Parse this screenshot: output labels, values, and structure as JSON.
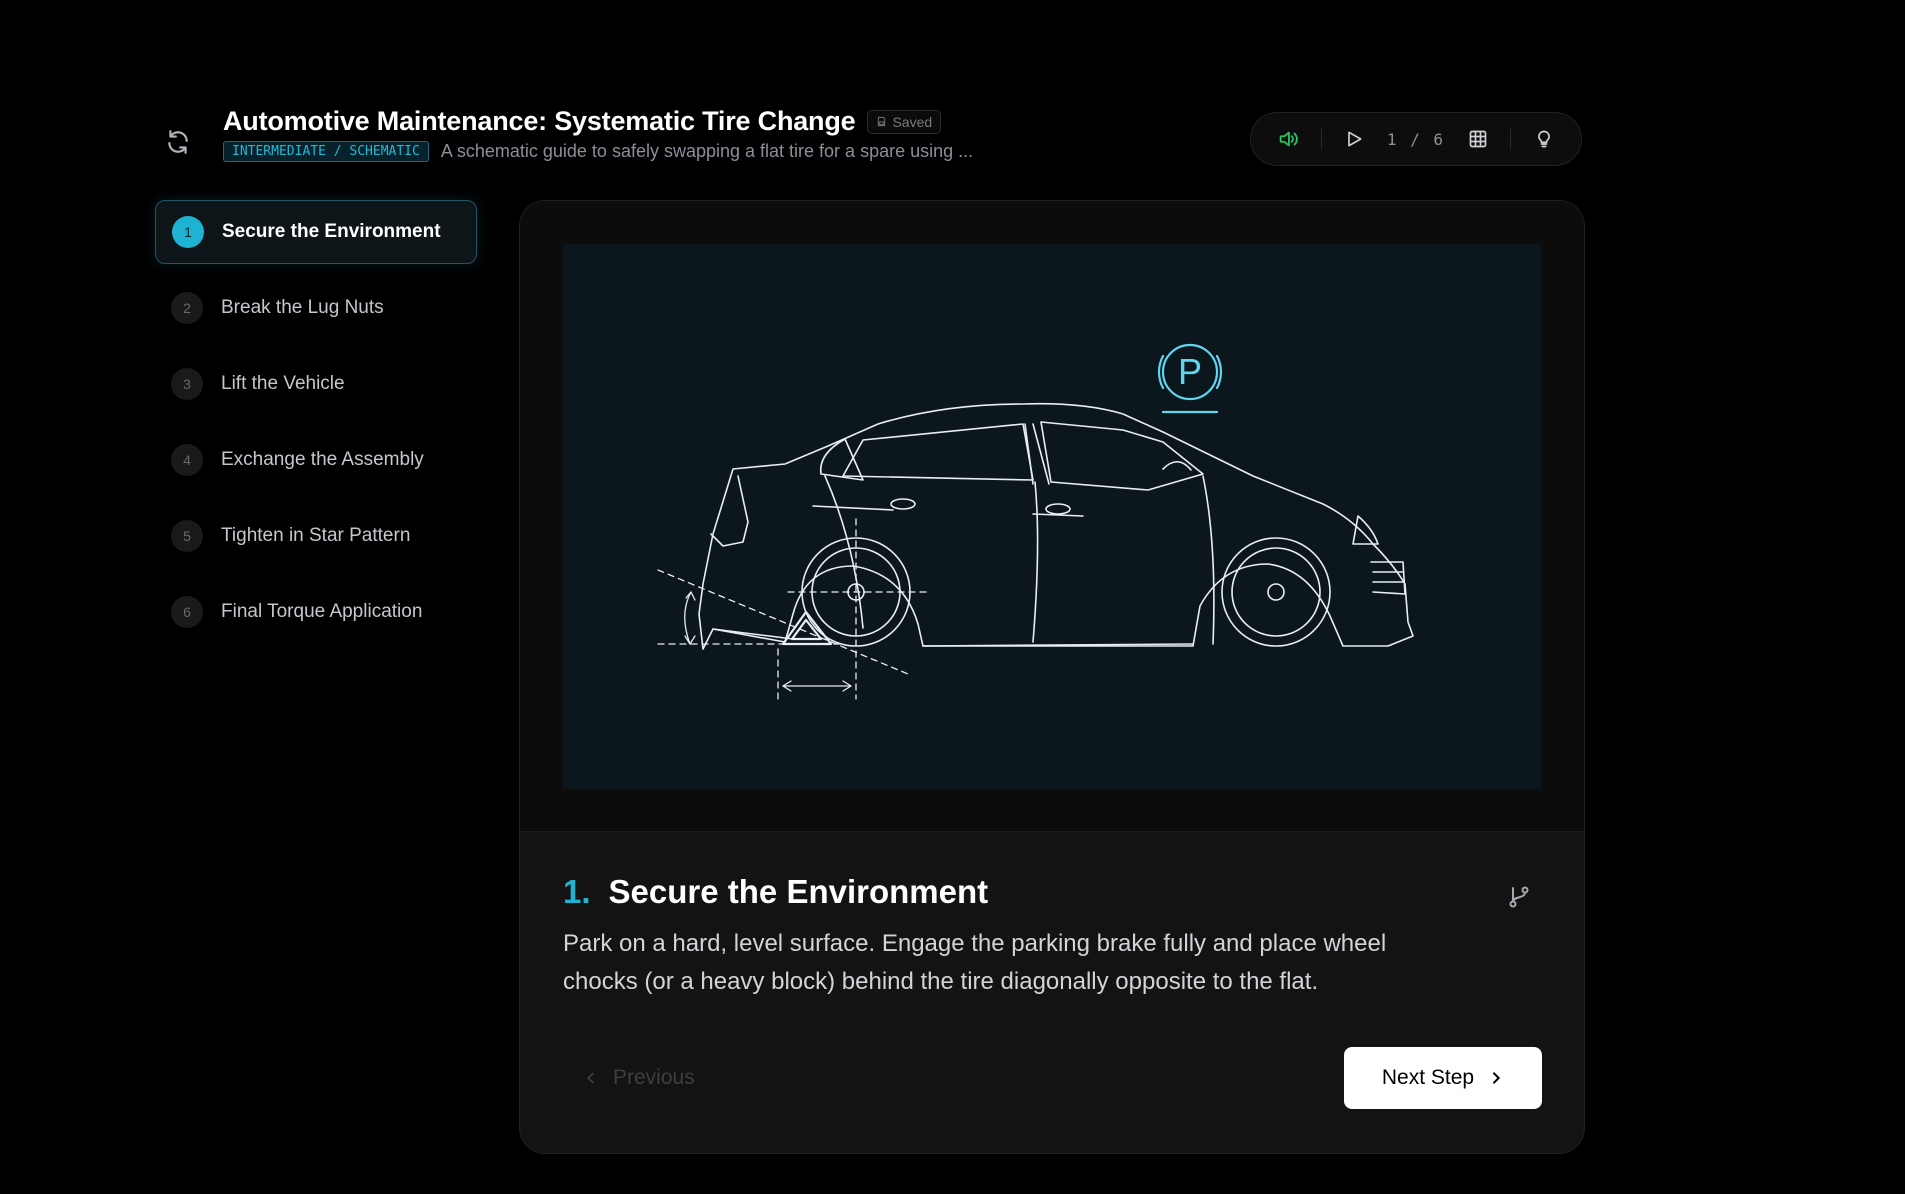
{
  "header": {
    "title": "Automotive Maintenance: Systematic Tire Change",
    "saved_label": "Saved",
    "level": "INTERMEDIATE / SCHEMATIC",
    "subtitle": "A schematic guide to safely swapping a flat tire for a spare using ..."
  },
  "toolbar": {
    "page_current": "1",
    "page_sep": "/",
    "page_total": "6"
  },
  "sidebar": {
    "items": [
      {
        "num": "1",
        "label": "Secure the Environment"
      },
      {
        "num": "2",
        "label": "Break the Lug Nuts"
      },
      {
        "num": "3",
        "label": "Lift the Vehicle"
      },
      {
        "num": "4",
        "label": "Exchange the Assembly"
      },
      {
        "num": "5",
        "label": "Tighten in Star Pattern"
      },
      {
        "num": "6",
        "label": "Final Torque Application"
      }
    ]
  },
  "step": {
    "number": "1.",
    "title": "Secure the Environment",
    "description": "Park on a hard, level surface. Engage the parking brake fully and place wheel chocks (or a heavy block) behind the tire diagonally opposite to the flat.",
    "illustration_label": "P"
  },
  "nav": {
    "previous_label": "Previous",
    "next_label": "Next Step"
  },
  "colors": {
    "accent": "#1fb3d3",
    "sound_active": "#22c55e",
    "background": "#000000"
  },
  "icons": {
    "refresh": "refresh-icon",
    "sound": "speaker-icon",
    "play": "play-icon",
    "grid": "grid-icon",
    "hint": "lightbulb-icon",
    "branch": "branch-icon",
    "next": "chevron-right-icon",
    "previous": "chevron-left-icon"
  }
}
